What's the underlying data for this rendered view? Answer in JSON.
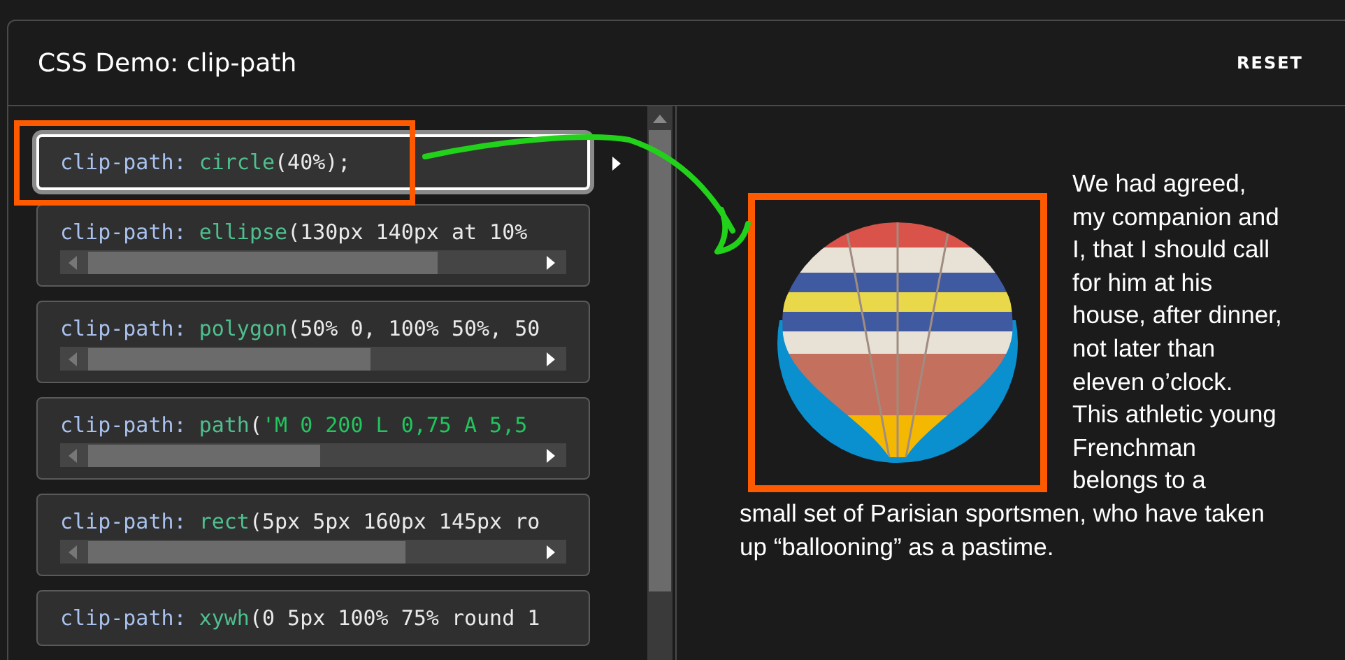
{
  "demo": {
    "title": "CSS Demo: clip-path",
    "reset_button": "RESET"
  },
  "examples": [
    {
      "selected": true,
      "scrollbar": false,
      "tokens": [
        {
          "kind": "property",
          "text": "clip-path: "
        },
        {
          "kind": "function",
          "text": "circle"
        },
        {
          "kind": "plain",
          "text": "(40%);"
        }
      ]
    },
    {
      "selected": false,
      "scrollbar": true,
      "tokens": [
        {
          "kind": "property",
          "text": "clip-path: "
        },
        {
          "kind": "function",
          "text": "ellipse"
        },
        {
          "kind": "plain",
          "text": "(130px 140px at 10%"
        }
      ]
    },
    {
      "selected": false,
      "scrollbar": true,
      "tokens": [
        {
          "kind": "property",
          "text": "clip-path: "
        },
        {
          "kind": "function",
          "text": "polygon"
        },
        {
          "kind": "plain",
          "text": "(50% 0, 100% 50%, 50"
        }
      ]
    },
    {
      "selected": false,
      "scrollbar": true,
      "tokens": [
        {
          "kind": "property",
          "text": "clip-path: "
        },
        {
          "kind": "function",
          "text": "path"
        },
        {
          "kind": "plain",
          "text": "("
        },
        {
          "kind": "string",
          "text": "'M 0 200 L 0,75 A 5,5"
        }
      ]
    },
    {
      "selected": false,
      "scrollbar": true,
      "tokens": [
        {
          "kind": "property",
          "text": "clip-path: "
        },
        {
          "kind": "function",
          "text": "rect"
        },
        {
          "kind": "plain",
          "text": "(5px 5px 160px 145px ro"
        }
      ]
    },
    {
      "selected": false,
      "tokens": [
        {
          "kind": "property",
          "text": "clip-path: "
        },
        {
          "kind": "function",
          "text": "xywh"
        },
        {
          "kind": "plain",
          "text": "(0 5px 100% 75% round 1"
        }
      ]
    }
  ],
  "output": {
    "paragraph_parts": [
      "We had agreed, my companion and I, that I should call for him at his house, after dinner, not later than eleven o’clock. This athletic young Frenchman belongs to a",
      "small set of Parisian sportsmen, who have taken up “ballooning” as a pastime."
    ]
  }
}
